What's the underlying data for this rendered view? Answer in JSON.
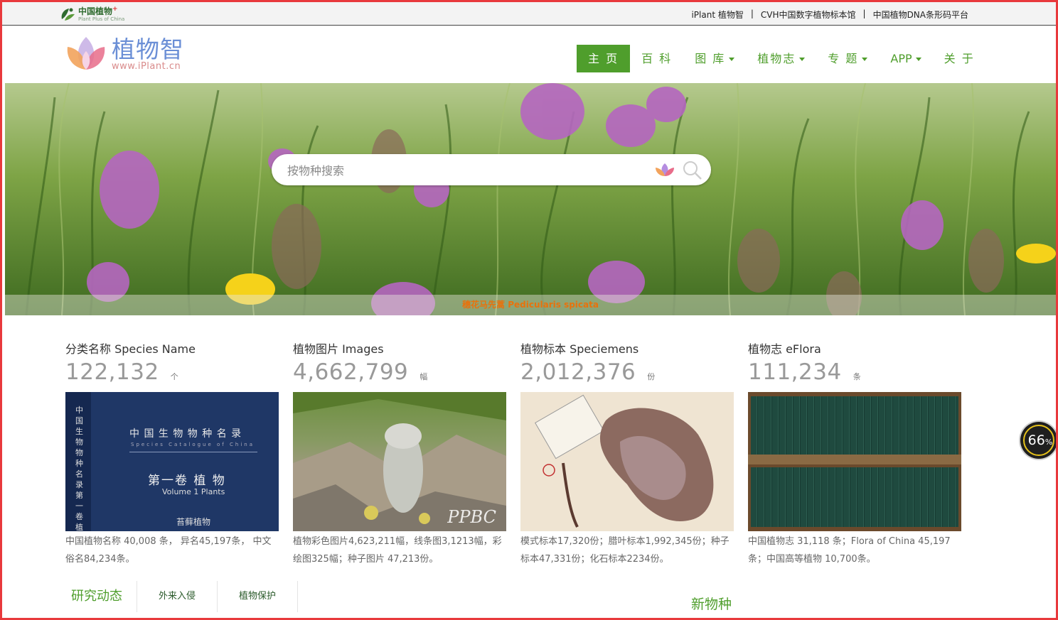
{
  "topbar": {
    "logo_cn": "中国植物",
    "logo_plus": "+",
    "logo_en": "Plant Plus of China",
    "links": [
      "iPlant 植物智",
      "CVH中国数字植物标本馆",
      "中国植物DNA条形码平台"
    ],
    "separator": "|"
  },
  "header": {
    "logo_cn": "植物智",
    "logo_en": "www.iPlant.cn",
    "nav": [
      {
        "label": "主 页",
        "active": true,
        "dropdown": false
      },
      {
        "label": "百 科",
        "active": false,
        "dropdown": false
      },
      {
        "label": "图 库",
        "active": false,
        "dropdown": true
      },
      {
        "label": "植物志",
        "active": false,
        "dropdown": true
      },
      {
        "label": "专 题",
        "active": false,
        "dropdown": true
      },
      {
        "label": "APP",
        "active": false,
        "dropdown": true
      },
      {
        "label": "关 于",
        "active": false,
        "dropdown": false
      }
    ]
  },
  "hero": {
    "search_placeholder": "按物种搜索",
    "caption": "穗花马先蒿 Pedicularis spicata"
  },
  "stats": [
    {
      "label": "分类名称 Species Name",
      "value": "122,132",
      "unit": "个",
      "desc": "中国植物名称 40,008 条， 异名45,197条， 中文俗名84,234条。",
      "book_title": "中 国 生 物 物 种 名 录",
      "book_sub": "Species Catalogue of China",
      "book_vol": "第一卷 植 物",
      "book_vol_en": "Volume 1 Plants",
      "book_part": "苔藓植物",
      "book_spine": "中国生物物种名录 第一卷 植"
    },
    {
      "label": "植物图片 Images",
      "value": "4,662,799",
      "unit": "幅",
      "desc": "植物彩色图片4,623,211幅，线条图3,1213幅，彩绘图325幅；种子图片 47,213份。",
      "watermark": "PPBC"
    },
    {
      "label": "植物标本 Speciemens",
      "value": "2,012,376",
      "unit": "份",
      "desc": "模式标本17,320份；腊叶标本1,992,345份；种子标本47,331份；化石标本2234份。"
    },
    {
      "label": "植物志 eFlora",
      "value": "111,234",
      "unit": "条",
      "desc": "中国植物志 31,118 条；Flora of China 45,197条；中国高等植物 10,700条。"
    }
  ],
  "tabs": [
    "研究动态",
    "外来入侵",
    "植物保护"
  ],
  "new_species": "新物种",
  "progress": {
    "value": "66",
    "unit": "%"
  },
  "colors": {
    "accent": "#4f9e2c",
    "frame": "#e8393c",
    "caption": "#e8720c"
  }
}
